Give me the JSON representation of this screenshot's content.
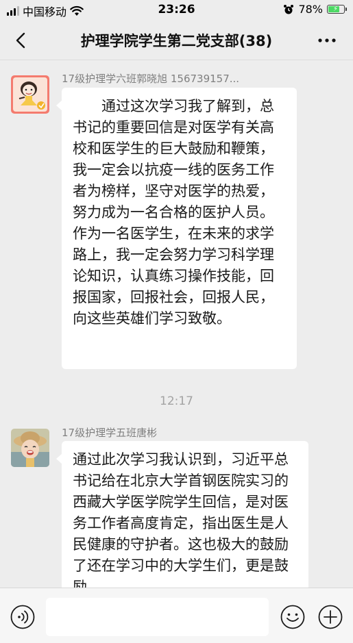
{
  "status_bar": {
    "carrier": "中国移动",
    "time": "23:26",
    "battery_percent": "78%",
    "battery_level": 0.78,
    "icons": [
      "signal-icon",
      "wifi-icon",
      "alarm-icon",
      "battery-icon"
    ]
  },
  "nav": {
    "title": "护理学院学生第二党支部(38)",
    "back_icon": "chevron-left-icon",
    "more_icon": "more-dots-icon"
  },
  "messages": [
    {
      "sender": "17级护理学六班郭晓旭 156739157...",
      "avatar": "cartoon-girl-avatar",
      "paragraphs": [
        "　　通过这次学习我了解到，总书记的重要回信是对医学有关高校和医学生的巨大鼓励和鞭策，我一定会以抗疫一线的医务工作者为榜样，坚守对医学的热爱，努力成为一名合格的医护人员。",
        "作为一名医学生，在未来的求学路上，我一定会努力学习科学理论知识，认真练习操作技能，回报国家，回报社会，回报人民，向这些英雄们学习致敬。"
      ]
    },
    {
      "sender": "17级护理学五班唐彬",
      "avatar": "child-photo-avatar",
      "paragraphs": [
        "通过此次学习我认识到，习近平总书记给在北京大学首钢医院实习的西藏大学医学院学生回信，是对医务工作者高度肯定，指出医生是人民健康的守护者。这也极大的鼓励了还在学习中的大学生们，更是鼓励"
      ]
    }
  ],
  "time_divider": "12:17",
  "input_bar": {
    "placeholder": "",
    "value": "",
    "voice_icon": "voice-icon",
    "emoji_icon": "emoji-icon",
    "plus_icon": "plus-icon"
  },
  "colors": {
    "background": "#ededed",
    "bubble": "#ffffff",
    "battery_fill": "#4cd964"
  }
}
